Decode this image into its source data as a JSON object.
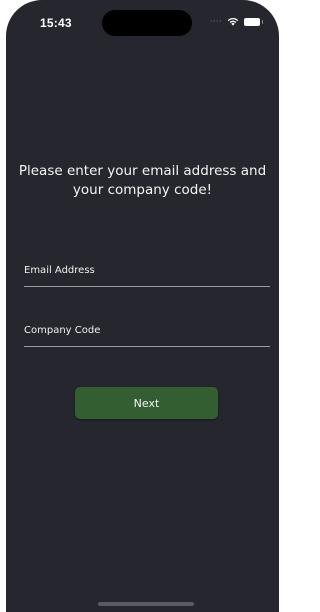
{
  "status_bar": {
    "time": "15:43",
    "signal_icon": "cellular-dots-icon",
    "wifi_icon": "wifi-icon",
    "battery_icon": "battery-icon"
  },
  "form": {
    "prompt": "Please enter your email address and your company code!",
    "email": {
      "placeholder": "Email Address",
      "value": ""
    },
    "company_code": {
      "placeholder": "Company Code",
      "value": ""
    },
    "next_label": "Next"
  },
  "colors": {
    "background": "#26262e",
    "button": "#335e32",
    "divider": "#9a9aa2",
    "text": "#ffffff"
  }
}
